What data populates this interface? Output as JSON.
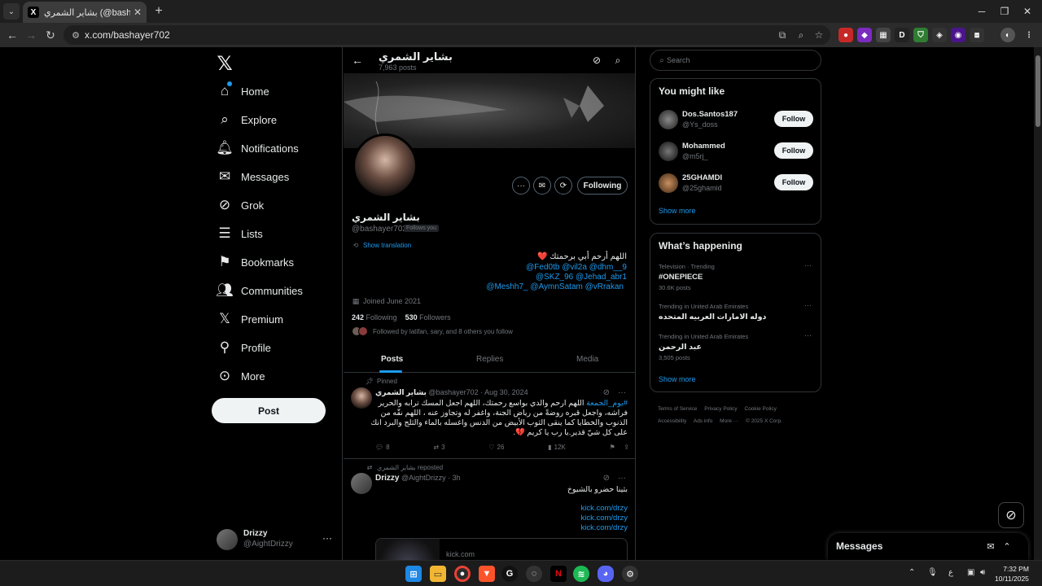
{
  "browser": {
    "tab_title": "بشاير الشمري (@bashayer702) / X",
    "favicon": "X",
    "url": "x.com/bashayer702"
  },
  "nav": {
    "items": [
      {
        "label": "Home",
        "icon": "home-icon"
      },
      {
        "label": "Explore",
        "icon": "search-icon"
      },
      {
        "label": "Notifications",
        "icon": "bell-icon"
      },
      {
        "label": "Messages",
        "icon": "envelope-icon"
      },
      {
        "label": "Grok",
        "icon": "grok-icon"
      },
      {
        "label": "Lists",
        "icon": "list-icon"
      },
      {
        "label": "Bookmarks",
        "icon": "bookmark-icon"
      },
      {
        "label": "Communities",
        "icon": "people-icon"
      },
      {
        "label": "Premium",
        "icon": "x-icon"
      },
      {
        "label": "Profile",
        "icon": "person-icon"
      },
      {
        "label": "More",
        "icon": "more-circle-icon"
      }
    ],
    "post_button": "Post",
    "account": {
      "name": "Drizzy",
      "handle": "@AightDrizzy"
    }
  },
  "profile": {
    "header_name": "بشاير الشمري",
    "post_count": "7,963 posts",
    "display_name": "بشاير الشمري",
    "handle": "@bashayer702",
    "follows_you": "Follows you",
    "show_translation": "Show translation",
    "bio_line1": "اللهم أرحم أبي برحمتك ❤️",
    "bio_line2": "@Fed0tb @vil2a @dhm__9",
    "bio_line3": "@SKZ_96 @Jehad_abr1",
    "bio_line4": "@Meshh7_ @AymnSatam @vRrakan",
    "joined": "Joined June 2021",
    "following_count": "242",
    "following_label": "Following",
    "followers_count": "530",
    "followers_label": "Followers",
    "followed_by": "Followed by latifan, sary, and 8 others you follow",
    "following_button": "Following",
    "tabs": [
      "Posts",
      "Replies",
      "Media"
    ]
  },
  "tweets": {
    "pinned": {
      "context": "Pinned",
      "name": "بشاير الشمري",
      "handle": "@bashayer702",
      "date": "· Aug 30, 2024",
      "hashtag": "#يوم_الجمعة",
      "body": " اللهم ارحم والدي بواسع رحمتك، اللهم اجعل المسك ترابه والحرير فراشه، واجعل قبره روضةً من رياض الجنة، واغفر له وتجاوز عنه ، اللهم نقّه من الذنوب والخطايا كما ينقى الثوب الأبيض من الدنس واغسله بالماء والثلج والبرد انك على كل شيّ قدير.يا رب يا كريم 💔.",
      "replies": "8",
      "reposts": "3",
      "likes": "26",
      "views": "12K"
    },
    "repost": {
      "context": "بشاير الشمري reposted",
      "name": "Drizzy",
      "handle": "@AightDrizzy",
      "date": "· 3h",
      "body": "بثينا حضرو بالشيوخ",
      "link1": "kick.com/drzy",
      "link2": "kick.com/drzy",
      "link3": "kick.com/drzy",
      "card_domain": "kick.com"
    }
  },
  "right": {
    "search_placeholder": "Search",
    "might_like_title": "You might like",
    "suggestions": [
      {
        "name": "Dos.Santos187",
        "handle": "@Ys_doss",
        "button": "Follow"
      },
      {
        "name": "Mohammed",
        "handle": "@m5rj_",
        "button": "Follow"
      },
      {
        "name": "25GHAMDI",
        "handle": "@25ghamid",
        "button": "Follow"
      }
    ],
    "show_more": "Show more",
    "happening_title": "What’s happening",
    "trends": [
      {
        "context": "Television · Trending",
        "name": "#ONEPIECE",
        "count": "30.6K posts"
      },
      {
        "context": "Trending in United Arab Emirates",
        "name": "دوله الامارات العربيه المتحده",
        "count": ""
      },
      {
        "context": "Trending in United Arab Emirates",
        "name": "عبد الرحمن",
        "count": "3,505 posts"
      }
    ],
    "show_more_2": "Show more",
    "footer": [
      "Terms of Service",
      "Privacy Policy",
      "Cookie Policy",
      "Accessibility",
      "Ads info",
      "More ···",
      "© 2025 X Corp."
    ]
  },
  "messages_drawer": {
    "title": "Messages"
  },
  "taskbar": {
    "time": "7:32 PM",
    "date": "10/11/2025",
    "lang": "ع"
  }
}
